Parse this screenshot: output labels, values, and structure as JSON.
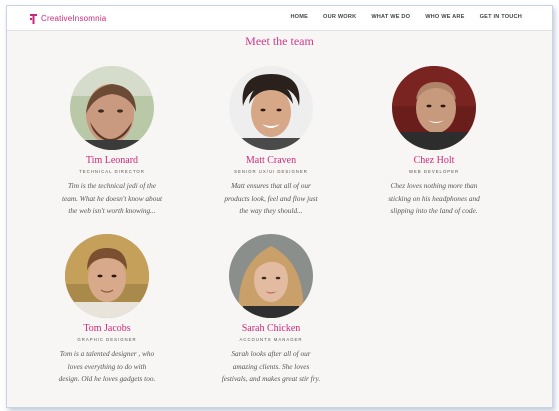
{
  "brand": {
    "name": "CreativeInsomnia",
    "color": "#c8287a",
    "icon": "creative-insomnia-logo"
  },
  "nav": {
    "items": [
      {
        "label": "HOME"
      },
      {
        "label": "OUR WORK"
      },
      {
        "label": "WHAT WE DO"
      },
      {
        "label": "WHO WE ARE"
      },
      {
        "label": "GET IN TOUCH"
      }
    ]
  },
  "section": {
    "title": "Meet the team"
  },
  "team": [
    {
      "name": "Tim Leonard",
      "role": "TECHNICAL DIRECTOR",
      "bio": [
        "Tim is the technical jedi of the",
        "team. What he doesn't know about",
        "the web isn't worth knowing..."
      ]
    },
    {
      "name": "Matt Craven",
      "role": "SENIOR UX/UI DESIGNER",
      "bio": [
        "Matt ensures that all of our",
        "products look, feel and flow just",
        "the way they should..."
      ]
    },
    {
      "name": "Chez Holt",
      "role": "WEB DEVELOPER",
      "bio": [
        "Chez loves nothing more than",
        "sticking on his headphones and",
        "slipping into the land of code."
      ]
    },
    {
      "name": "Tom Jacobs",
      "role": "GRAPHIC DESIGNER",
      "bio": [
        "Tom is a talented designer , who",
        "loves everything to do with",
        "design. Old he loves gadgets too."
      ]
    },
    {
      "name": "Sarah Chicken",
      "role": "ACCOUNTS MANAGER",
      "bio": [
        "Sarah looks after all of our",
        "amazing clients. She loves",
        "festivals, and makes great stir fry."
      ]
    }
  ]
}
